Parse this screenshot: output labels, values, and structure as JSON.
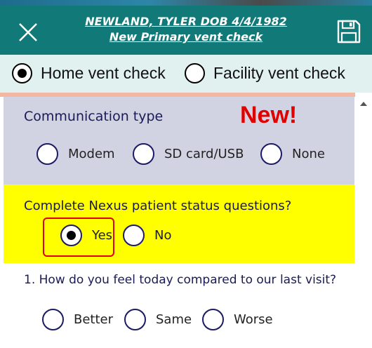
{
  "header": {
    "patient_line": "NEWLAND, TYLER  DOB 4/4/1982",
    "subtitle": "New Primary vent check",
    "close_icon": "close-icon",
    "save_icon": "save-icon",
    "background_color": "#117a78"
  },
  "check_type": {
    "options": [
      {
        "label": "Home vent check",
        "selected": true
      },
      {
        "label": "Facility vent check",
        "selected": false
      }
    ]
  },
  "communication": {
    "title": "Communication type",
    "badge": "New!",
    "options": [
      {
        "label": "Modem",
        "selected": false
      },
      {
        "label": "SD card/USB",
        "selected": false
      },
      {
        "label": "None",
        "selected": false
      }
    ]
  },
  "nexus": {
    "title": "Complete Nexus patient status questions?",
    "options": [
      {
        "label": "Yes",
        "selected": true
      },
      {
        "label": "No",
        "selected": false
      }
    ]
  },
  "question1": {
    "title": "1. How do you feel today compared to our last visit?",
    "options": [
      {
        "label": "Better",
        "selected": false
      },
      {
        "label": "Same",
        "selected": false
      },
      {
        "label": "Worse",
        "selected": false
      }
    ]
  },
  "colors": {
    "comm_section_bg": "#d2d3e2",
    "nexus_section_bg": "#ffff00",
    "badge_color": "#e00000",
    "radio_ring_color": "#1b1b66"
  }
}
